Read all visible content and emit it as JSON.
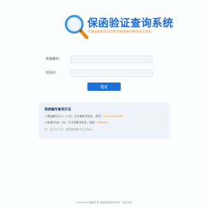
{
  "header": {
    "title": "保函验证查询系统",
    "subtitle": "可通过本系统对您所开保函进行真伪验证查询"
  },
  "form": {
    "guarantee_no_label": "保函编号：",
    "guarantee_no_value": "",
    "code_label": "验证码：",
    "code_value": "",
    "submit_label": "验证"
  },
  "instructions": {
    "title": "保函编号查询方法",
    "line1_prefix": "1.保函编号为12~13位，为半角数字组合。例如：",
    "line1_example": "202110000001",
    "line2_prefix": "2.查询码为6~7位，为半角数字组合。例如：",
    "line2_example": "969696",
    "note": "注：区分大小写，但是查询会不区分显示。"
  },
  "footer": {
    "text": "Copyright 版权所有 保函验证查询系统 · 技术支持"
  },
  "colors": {
    "brand": "#1e6bd6",
    "accent": "#f08c1a",
    "button": "#1e6fd9"
  }
}
